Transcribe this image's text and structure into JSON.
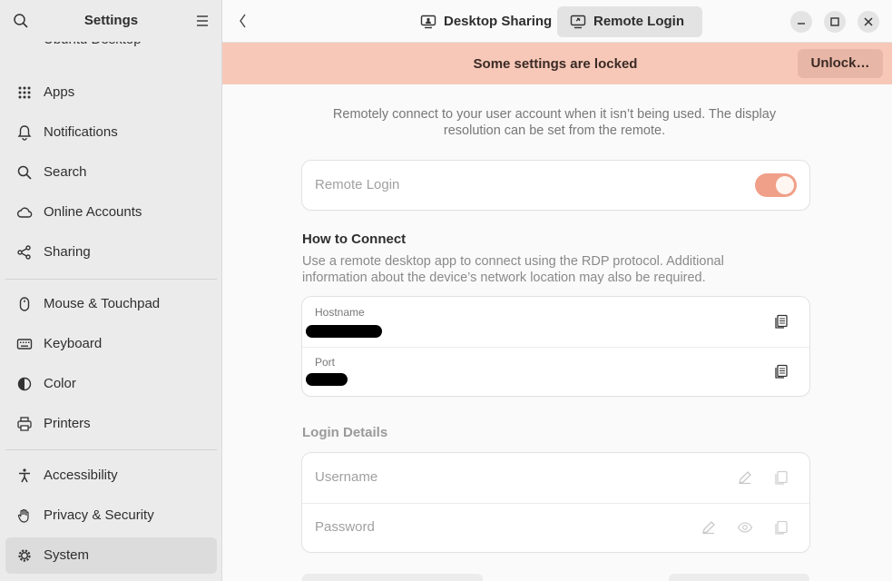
{
  "sidebar": {
    "title": "Settings",
    "partial_item": "Ubuntu Desktop",
    "items": [
      {
        "label": "Apps",
        "icon": "apps-icon"
      },
      {
        "label": "Notifications",
        "icon": "bell-icon"
      },
      {
        "label": "Search",
        "icon": "search-icon"
      },
      {
        "label": "Online Accounts",
        "icon": "cloud-icon"
      },
      {
        "label": "Sharing",
        "icon": "share-icon"
      },
      {
        "label": "Mouse & Touchpad",
        "icon": "mouse-icon"
      },
      {
        "label": "Keyboard",
        "icon": "keyboard-icon"
      },
      {
        "label": "Color",
        "icon": "color-icon"
      },
      {
        "label": "Printers",
        "icon": "printer-icon"
      },
      {
        "label": "Accessibility",
        "icon": "accessibility-icon"
      },
      {
        "label": "Privacy & Security",
        "icon": "hand-icon"
      },
      {
        "label": "System",
        "icon": "gear-icon"
      }
    ]
  },
  "header": {
    "tabs": [
      {
        "label": "Desktop Sharing",
        "icon": "desktop-sharing-icon"
      },
      {
        "label": "Remote Login",
        "icon": "remote-login-icon"
      }
    ]
  },
  "banner": {
    "message": "Some settings are locked",
    "unlock_label": "Unlock…"
  },
  "content": {
    "intro": "Remotely connect to your user account when it isn’t being used. The display resolution can be set from the remote.",
    "remote_login_label": "Remote Login",
    "remote_login_enabled": true,
    "how_title": "How to Connect",
    "how_desc": "Use a remote desktop app to connect using the RDP protocol. Additional information about the device’s network location may also be required.",
    "hostname_label": "Hostname",
    "port_label": "Port",
    "login_title": "Login Details",
    "username_label": "Username",
    "password_label": "Password"
  },
  "colors": {
    "accent": "#f0a088",
    "banner": "#f7c8b8"
  }
}
